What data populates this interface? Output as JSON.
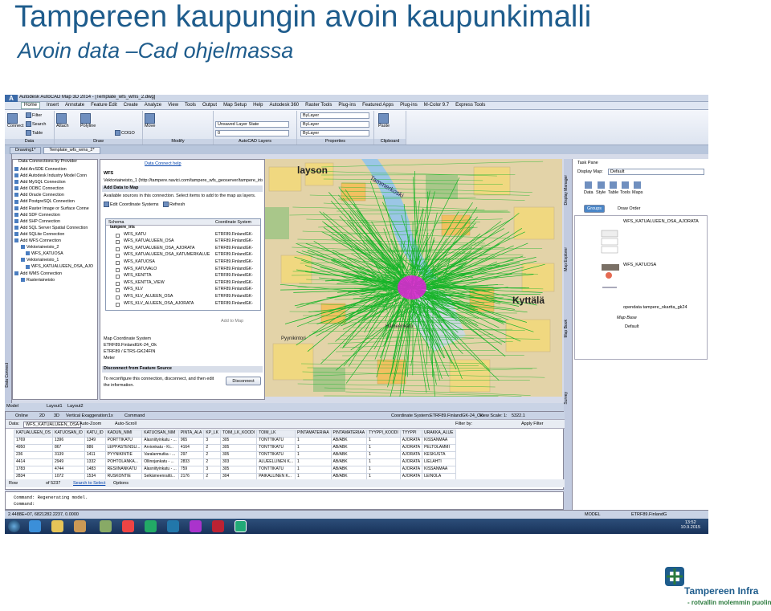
{
  "slide": {
    "title": "Tampereen kaupungin avoin kaupunkimalli",
    "subtitle": "Avoin data –Cad ohjelmassa",
    "logo_name": "Tampereen Infra",
    "logo_tagline": "- rotvallin molemmin puolin"
  },
  "app": {
    "window_title": "Autodesk AutoCAD Map 3D 2014 - [Template_wfs_wms_2.dwg]",
    "ribbon_tabs": [
      "Home",
      "Insert",
      "Annotate",
      "Feature Edit",
      "Create",
      "Analyze",
      "View",
      "Tools",
      "Output",
      "Map Setup",
      "Help",
      "Autodesk 360",
      "Raster Tools",
      "Plug-ins",
      "Featured Apps",
      "Plug-ins",
      "M-Color 9.7",
      "Express Tools"
    ],
    "active_tab": "Home",
    "ribbon": {
      "connect": "Connect",
      "filter": "Filter",
      "search": "Search",
      "table": "Table",
      "attach": "Attach",
      "polyline": "Polyline",
      "cogo": "COGO",
      "move": "Move",
      "layer_state": "Unsaved Layer State",
      "bylayer": "ByLayer",
      "zero": "0",
      "paste": "Paste",
      "panels": [
        "Data",
        "Draw",
        "Modify",
        "AutoCAD Layers",
        "Properties",
        "Clipboard"
      ]
    },
    "file_tabs": [
      "Drawing1*",
      "Template_wfs_wms_2*"
    ],
    "left_strip_label": "Data Connect",
    "data_connect": {
      "header": "Data Connections by Provider",
      "items": [
        {
          "label": "Add ArcSDE Connection",
          "level": 0
        },
        {
          "label": "Add Autodesk Industry Model Conn",
          "level": 0
        },
        {
          "label": "Add MySQL Connection",
          "level": 0
        },
        {
          "label": "Add ODBC Connection",
          "level": 0
        },
        {
          "label": "Add Oracle Connection",
          "level": 0
        },
        {
          "label": "Add PostgreSQL Connection",
          "level": 0
        },
        {
          "label": "Add Raster Image or Surface Conne",
          "level": 0
        },
        {
          "label": "Add SDF Connection",
          "level": 0
        },
        {
          "label": "Add SHP Connection",
          "level": 0
        },
        {
          "label": "Add SQL Server Spatial Connection",
          "level": 0
        },
        {
          "label": "Add SQLite Connection",
          "level": 0
        },
        {
          "label": "Add WFS Connection",
          "level": 0
        },
        {
          "label": "Vektoriaineisto_2",
          "level": 1
        },
        {
          "label": "WFS_KATUOSA",
          "level": 2
        },
        {
          "label": "Vektoriaineisto_1",
          "level": 1
        },
        {
          "label": "WFS_KATUALUEEN_OSA_AJO",
          "level": 2
        },
        {
          "label": "Add WMS Connection",
          "level": 0
        },
        {
          "label": "Rasteriaineisto",
          "level": 1
        }
      ]
    },
    "wfs_panel": {
      "help": "Data Connect help",
      "heading": "WFS",
      "url": "Vektoriaineisto_1  (http://tampere.navici.com/tampere_wfs_geoserver/tampere_iris/ows?ve",
      "add_data": "Add Data to Map",
      "available": "Available sources in this connection.  Select items to add to the map as layers.",
      "edit_cs": "Edit Coordinate Systems",
      "refresh": "Refresh",
      "col_schema": "Schema",
      "col_cs": "Coordinate System",
      "schema_root": "tampere_iris",
      "rows": [
        {
          "name": "WFS_KATU",
          "cs": "ETRF89.FinlandGK-"
        },
        {
          "name": "WFS_KATUALUEEN_OSA",
          "cs": "ETRF89.FinlandGK-"
        },
        {
          "name": "WFS_KATUALUEEN_OSA_AJORATA",
          "cs": "ETRF89.FinlandGK-"
        },
        {
          "name": "WFS_KATUALUEEN_OSA_KATUMERKALUE",
          "cs": "ETRF89.FinlandGK-"
        },
        {
          "name": "WFS_KATUOSA",
          "cs": "ETRF89.FinlandGK-"
        },
        {
          "name": "WFS_KATUVALO",
          "cs": "ETRF89.FinlandGK-"
        },
        {
          "name": "WFS_KENTTA",
          "cs": "ETRF89.FinlandGK-"
        },
        {
          "name": "WFS_KENTTA_VIEW",
          "cs": "ETRF89.FinlandGK-"
        },
        {
          "name": "WFS_KLV",
          "cs": "ETRF89.FinlandGK-"
        },
        {
          "name": "WFS_KLV_ALUEEN_OSA",
          "cs": "ETRF89.FinlandGK-"
        },
        {
          "name": "WFS_KLV_ALUEEN_OSA_AJORATA",
          "cs": "ETRF89.FinlandGK-"
        }
      ],
      "add_to_map": "Add to Map",
      "mcs_title": "Map Coordinate System",
      "mcs_line1": "ETRF89.FinlandGK-24_Ok",
      "mcs_line2": "ETRF89 / ETRS-GK24FIN",
      "mcs_line3": "Meter",
      "disconnect_bar": "Disconnect from Feature Source",
      "disconnect_text1": "To reconfigure this connection, disconnect, and then edit",
      "disconnect_text2": "the information.",
      "disconnect_btn": "Disconnect"
    },
    "map": {
      "labels": [
        "layson",
        "Tammerkoski",
        "Kyttälä",
        "Pyynikintori",
        "Hämeenkatu"
      ]
    },
    "layout_tabs": [
      "Model",
      "Layout1",
      "Layout2"
    ],
    "cmdbar": {
      "online": "Online",
      "view2d": "2D",
      "view3d": "3D",
      "vert": "Vertical Exaggeration:",
      "vert_val": "1x",
      "command": "Command",
      "cs_label": "Coordinate System:",
      "cs_val": "ETRF89.FinlandGK-24_Ok",
      "scale_label": "View Scale:",
      "scale_val": "1:",
      "scale_num": "5322.1"
    },
    "data_table": {
      "data_label": "Data:",
      "data_val": "WFS_KATUALUEEN_OSA",
      "autozoom": "Auto-Zoom",
      "autoscroll": "Auto-Scroll",
      "filter_by": "Filter by:",
      "apply_filter": "Apply Filter",
      "columns": [
        "KATUALUEEN_OS",
        "KATUOSAN_ID",
        "KATU_ID",
        "KADUN_NIMI",
        "KATUOSAN_NIM",
        "PINTA_ALA",
        "KP_LK",
        "TOIM_LK_KOODI",
        "TOIM_LK",
        "PINTAMATERIAA",
        "PINTAMATERIAA",
        "TYYPPI_KOODI",
        "TYYPPI",
        "URAKKA_ALUE"
      ],
      "rows": [
        [
          "1769",
          "1396",
          "1349",
          "PORTTIKATU",
          "Alasniityinkatu - ...",
          "965",
          "3",
          "305",
          "TONTTIKATU",
          "1",
          "AB/ABK",
          "1",
          "AJORATA",
          "KISSANMAA"
        ],
        [
          "4950",
          "867",
          "886",
          "LEPPÄSTENSU...",
          "Arvionkatu - Ki...",
          "4164",
          "2",
          "305",
          "TONTTIKATU",
          "1",
          "AB/ABK",
          "1",
          "AJORATA",
          "PELTOLAMMI"
        ],
        [
          "236",
          "3139",
          "1411",
          "PYYNIKINTIE",
          "Varalanmutka - ...",
          "297",
          "2",
          "305",
          "TONTTIKATU",
          "1",
          "AB/ABK",
          "1",
          "AJORATA",
          "KESKUSTA"
        ],
        [
          "4414",
          "2949",
          "1332",
          "POHTOLANKA...",
          "Ollinojankatu - ...",
          "2833",
          "2",
          "303",
          "ALUEELLINEN K...",
          "1",
          "AB/ABK",
          "1",
          "AJORATA",
          "LIELAHTI"
        ],
        [
          "1783",
          "4744",
          "1483",
          "RESIINANKATU",
          "Alasniityinkatu - ...",
          "759",
          "3",
          "305",
          "TONTTIKATU",
          "1",
          "AB/ABK",
          "1",
          "AJORATA",
          "KISSANMAA"
        ],
        [
          "2834",
          "1072",
          "1534",
          "RUSKONTIE",
          "Selkämeenraitti...",
          "2176",
          "2",
          "304",
          "PAIKALLINEN K...",
          "1",
          "AB/ABK",
          "1",
          "AJORATA",
          "LEINOLA"
        ]
      ],
      "row_label": "Row",
      "of_label": "of 5237",
      "search_select": "Search to Select",
      "options": "Options"
    },
    "command_lines": [
      "Command:  Regenerating model.",
      "Command:"
    ],
    "status": {
      "coords": "2.4488E+07, 6821282.2237, 0.0000",
      "model": "MODEL",
      "cs": "ETRF89.FinlandG"
    },
    "task_pane": {
      "title": "Task Pane",
      "display_map_label": "Display Map:",
      "display_map_val": "Default",
      "tools": [
        "Data",
        "Style",
        "Table",
        "Tools",
        "Maps"
      ],
      "groups": "Groups",
      "draw_order": "Draw Order",
      "layers": [
        "WFS_KATUALUEEN_OSA_AJORATA",
        "WFS_KATUOSA",
        "opendata tampere_okartta_gk24",
        "Map Base",
        "Default"
      ],
      "side_tabs": [
        "Display Manager",
        "Map Explorer",
        "Map Book",
        "Survey"
      ]
    },
    "clock": {
      "time": "13:52",
      "date": "10.9.2015"
    }
  },
  "colors": {
    "title": "#1e5c8c",
    "logo_green": "#2a7a3c",
    "map_green": "#18b52a",
    "map_magenta": "#e020d8"
  }
}
